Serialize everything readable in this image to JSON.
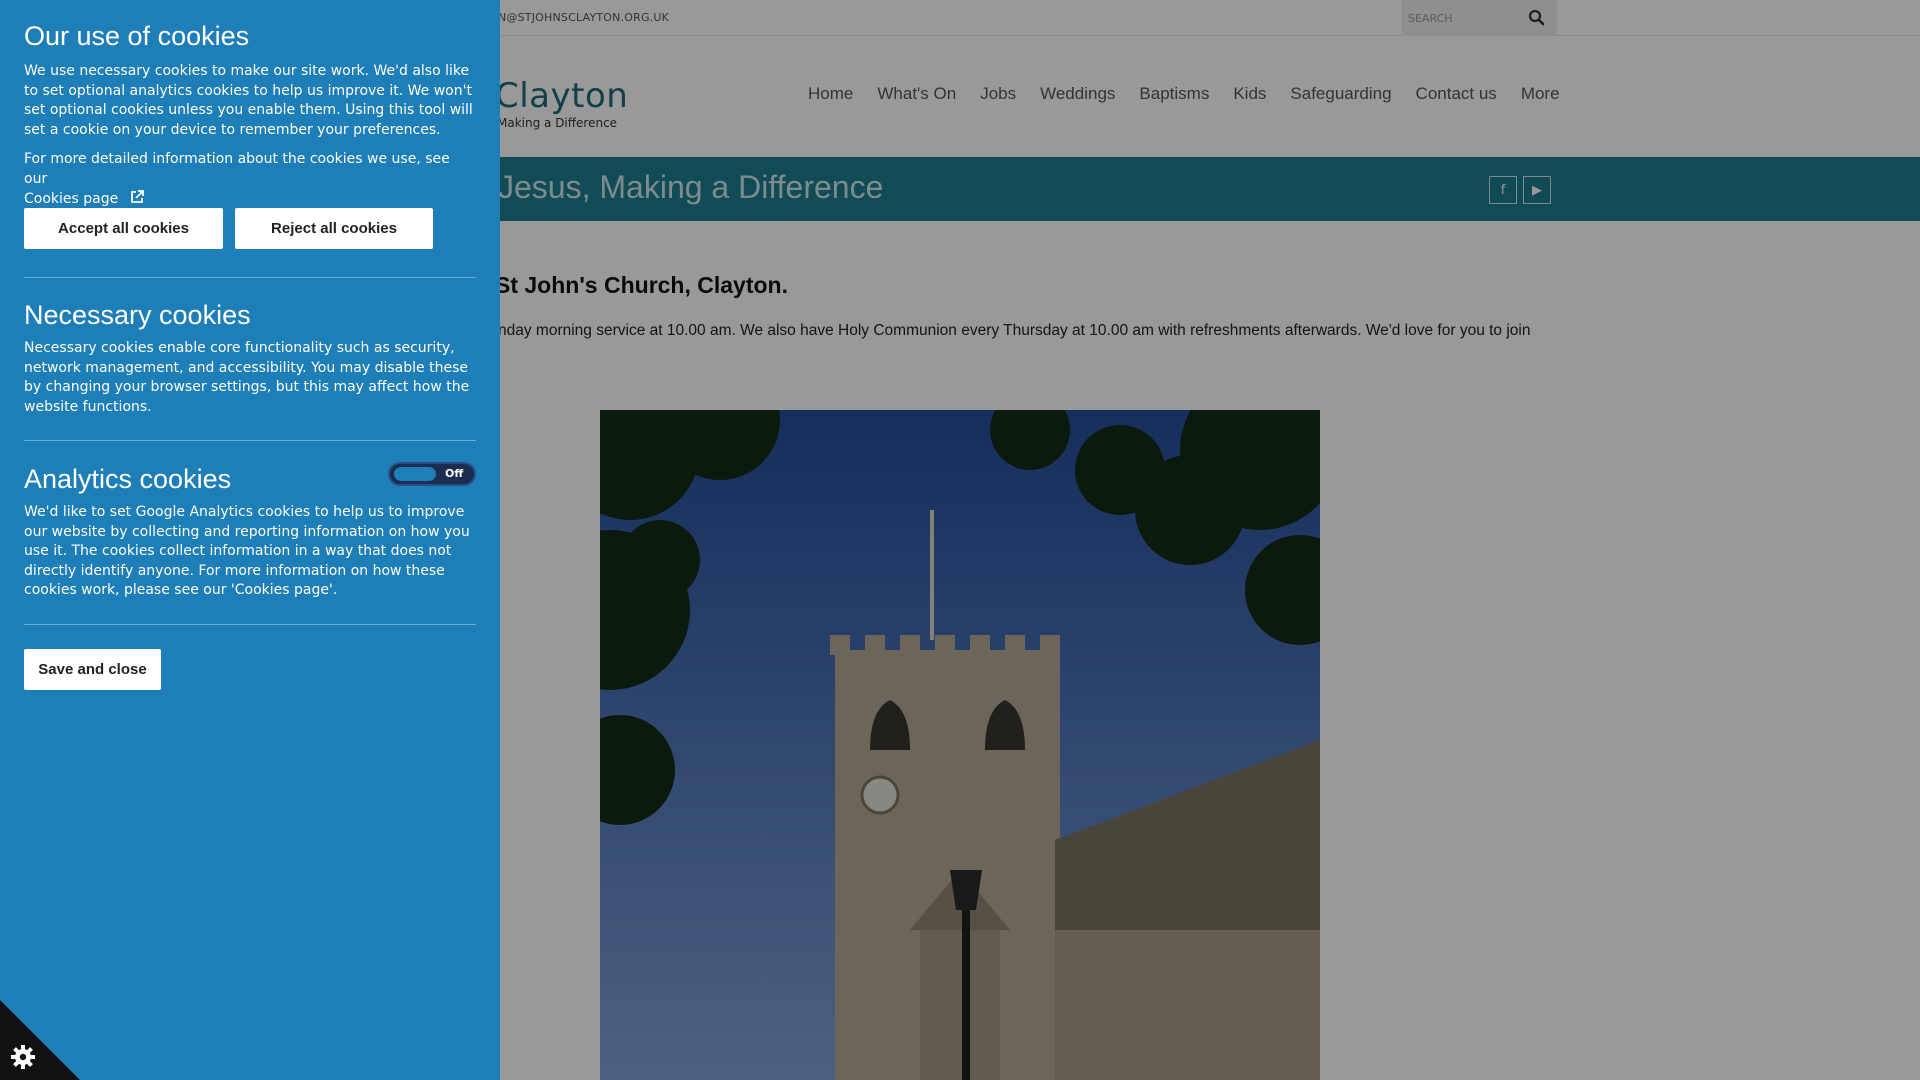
{
  "site": {
    "email": "N@STJOHNSCLAYTON.ORG.UK",
    "search": {
      "placeholder": "SEARCH"
    },
    "logo": {
      "word": "Clayton",
      "tagline": "Making a Difference"
    },
    "nav": [
      "Home",
      "What's On",
      "Jobs",
      "Weddings",
      "Baptisms",
      "Kids",
      "Safeguarding",
      "Contact us",
      "More"
    ],
    "banner": {
      "slogan": "Jesus, Making a Difference"
    },
    "social": {
      "facebook": "f",
      "youtube": "▶"
    },
    "content": {
      "title_bold": "St John's Church, Clayton",
      "title_tail": ".",
      "body": "nday morning service at 10.00 am.  We also have Holy Communion every Thursday at 10.00 am with refreshments afterwards.  We'd love for you to join"
    }
  },
  "cookie": {
    "title": "Our use of cookies",
    "intro": "We use necessary cookies to make our site work. We'd also like to set optional analytics cookies to help us improve it. We won't set optional cookies unless you enable them. Using this tool will set a cookie on your device to remember your preferences.",
    "more_info": "For more detailed information about the cookies we use, see our",
    "cookies_page_link": "Cookies page",
    "accept_label": "Accept all cookies",
    "reject_label": "Reject all cookies",
    "necessary": {
      "title": "Necessary cookies",
      "text": "Necessary cookies enable core functionality such as security, network management, and accessibility. You may disable these by changing your browser settings, but this may affect how the website functions."
    },
    "analytics": {
      "title": "Analytics cookies",
      "toggle_state": "Off",
      "text": "We'd like to set Google Analytics cookies to help us to improve our website by collecting and reporting information on how you use it. The cookies collect information in a way that does not directly identify anyone. For more information on how these cookies work, please see our 'Cookies page'."
    },
    "save_label": "Save and close"
  },
  "colors": {
    "panel": "#1e7eb8",
    "banner": "#1d7e8f",
    "toggle_track": "#1c2d50"
  },
  "icons": {
    "search": "search-icon",
    "external_link": "external-link-icon",
    "cookie": "cookie-icon"
  }
}
